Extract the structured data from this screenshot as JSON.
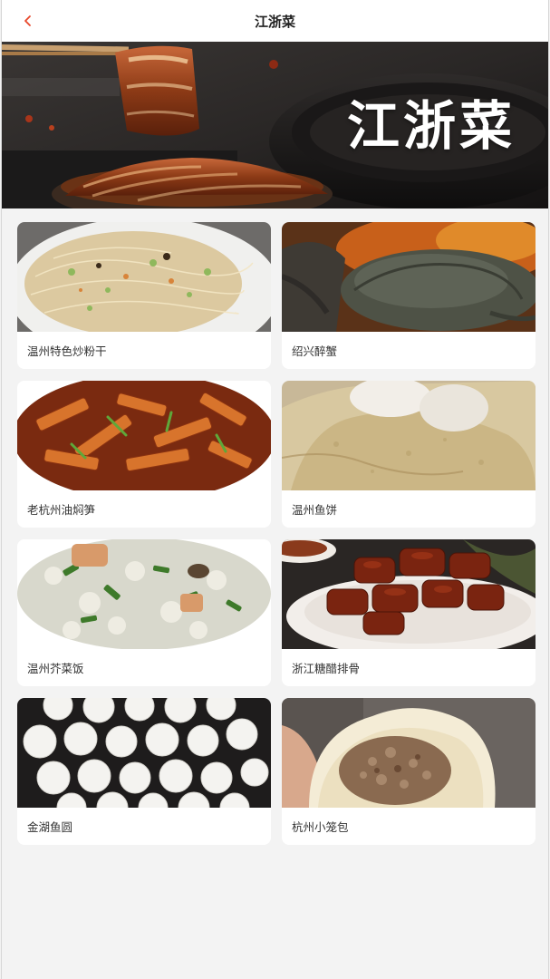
{
  "header": {
    "title": "江浙菜",
    "back_icon": "chevron-left-icon",
    "accent_color": "#e8472b"
  },
  "banner": {
    "title": "江浙菜"
  },
  "dishes": [
    {
      "name": "温州特色炒粉干",
      "image": "fried-rice-noodles-photo"
    },
    {
      "name": "绍兴醉蟹",
      "image": "drunken-crab-photo"
    },
    {
      "name": "老杭州油焖笋",
      "image": "braised-bamboo-shoots-photo"
    },
    {
      "name": "温州鱼饼",
      "image": "fish-cake-photo"
    },
    {
      "name": "温州芥菜饭",
      "image": "mustard-rice-photo"
    },
    {
      "name": "浙江糖醋排骨",
      "image": "sweet-sour-ribs-photo"
    },
    {
      "name": "金湖鱼圆",
      "image": "fish-balls-photo"
    },
    {
      "name": "杭州小笼包",
      "image": "xiaolongbao-photo"
    }
  ]
}
